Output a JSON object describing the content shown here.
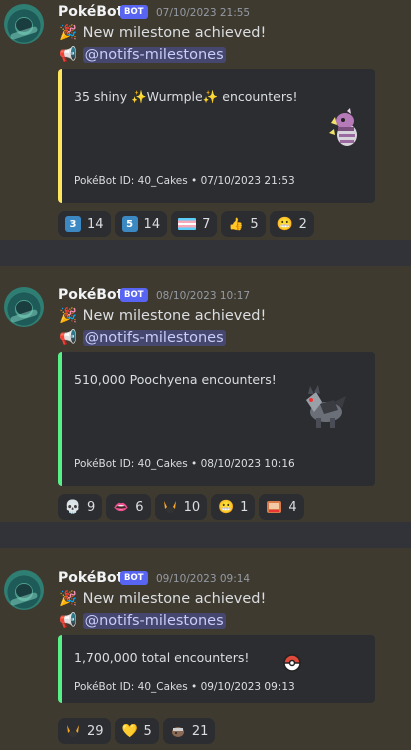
{
  "messages": [
    {
      "author": "PokéBot",
      "badge": "BOT",
      "timestamp": "07/10/2023 21:55",
      "line1": "New milestone achieved!",
      "mention": "@notifs-milestones",
      "embed": {
        "accent_color": "#fee75c",
        "description_pre": "35 shiny ",
        "description_name": "Wurmple",
        "description_post": " encounters!",
        "footer": "PokéBot ID: 40_Cakes • 07/10/2023 21:53",
        "thumbnail": "shiny-wurmple-sprite"
      },
      "reactions": [
        {
          "icon": "keycap-3-icon",
          "glyph": "3",
          "count": "14"
        },
        {
          "icon": "keycap-5-icon",
          "glyph": "5",
          "count": "14"
        },
        {
          "icon": "trans-flag-icon",
          "glyph": "",
          "count": "7"
        },
        {
          "icon": "thumbs-up-icon",
          "glyph": "👍",
          "count": "5"
        },
        {
          "icon": "grimace-face-icon",
          "glyph": "😬",
          "count": "2"
        }
      ]
    },
    {
      "author": "PokéBot",
      "badge": "BOT",
      "timestamp": "08/10/2023 10:17",
      "line1": "New milestone achieved!",
      "mention": "@notifs-milestones",
      "embed": {
        "accent_color": "#57f287",
        "description": "510,000 Poochyena encounters!",
        "footer": "PokéBot ID: 40_Cakes • 08/10/2023 10:16",
        "thumbnail": "poochyena-sprite"
      },
      "reactions": [
        {
          "icon": "skull-icon",
          "glyph": "💀",
          "count": "9"
        },
        {
          "icon": "mouth-icon",
          "glyph": "👄",
          "count": "6"
        },
        {
          "icon": "party-pokemon-icon",
          "glyph": "",
          "count": "10"
        },
        {
          "icon": "grimace-face-icon",
          "glyph": "😬",
          "count": "1"
        },
        {
          "icon": "pokemon-card-icon",
          "glyph": "",
          "count": "4"
        }
      ]
    },
    {
      "author": "PokéBot",
      "badge": "BOT",
      "timestamp": "09/10/2023 09:14",
      "line1": "New milestone achieved!",
      "mention": "@notifs-milestones",
      "embed": {
        "accent_color": "#57f287",
        "description": "1,700,000 total encounters!",
        "footer": "PokéBot ID: 40_Cakes • 09/10/2023 09:13",
        "thumbnail": "poke-ball-icon"
      },
      "reactions": [
        {
          "icon": "party-pokemon-icon",
          "glyph": "",
          "count": "29"
        },
        {
          "icon": "yellow-heart-icon",
          "glyph": "💛",
          "count": "5"
        },
        {
          "icon": "pokemon-sticker-icon",
          "glyph": "",
          "count": "21"
        }
      ]
    }
  ]
}
